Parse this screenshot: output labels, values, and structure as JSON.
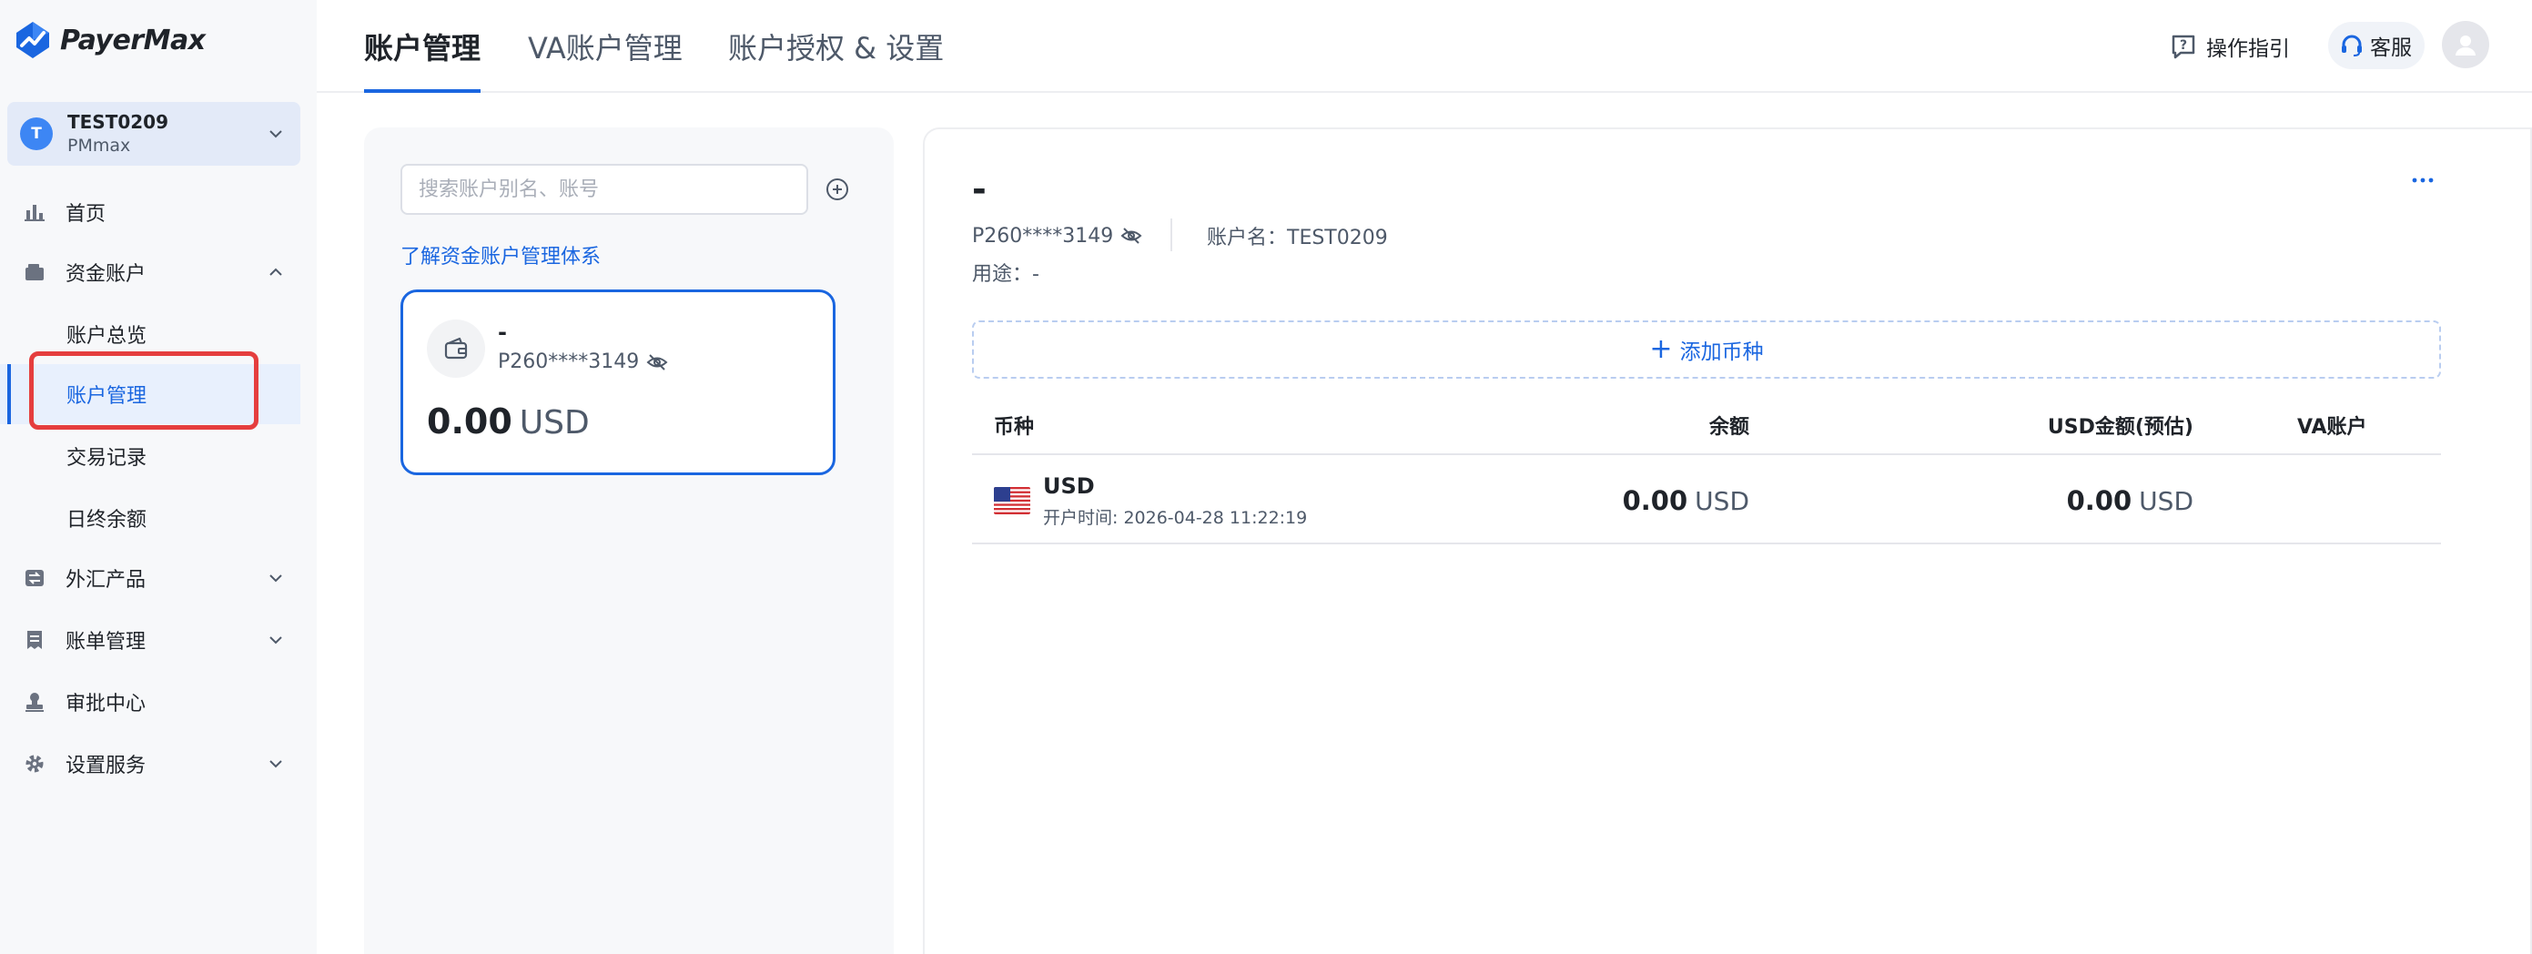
{
  "brand": {
    "name": "PayerMax"
  },
  "account_switch": {
    "avatar_letter": "T",
    "name": "TEST0209",
    "sub": "PMmax"
  },
  "nav": {
    "home": "首页",
    "funds": "资金账户",
    "funds_children": [
      "账户总览",
      "账户管理",
      "交易记录",
      "日终余额"
    ],
    "fx": "外汇产品",
    "bills": "账单管理",
    "approval": "审批中心",
    "settings": "设置服务"
  },
  "tabs": [
    "账户管理",
    "VA账户管理",
    "账户授权 & 设置"
  ],
  "header": {
    "guide": "操作指引",
    "service": "客服"
  },
  "left_panel": {
    "search_placeholder": "搜索账户别名、账号",
    "learn_link": "了解资金账户管理体系",
    "card": {
      "alias": "-",
      "number": "P260****3149",
      "amount": "0.00",
      "currency": "USD"
    }
  },
  "detail": {
    "title": "-",
    "number": "P260****3149",
    "account_name": "账户名：TEST0209",
    "usage": "用途：-",
    "add_currency": "添加币种",
    "columns": [
      "币种",
      "余额",
      "USD金额(预估)",
      "VA账户"
    ],
    "rows": [
      {
        "currency": "USD",
        "opened": "开户时间: 2026-04-28 11:22:19",
        "balance": "0.00",
        "balance_cur": "USD",
        "usd_amount": "0.00",
        "usd_cur": "USD",
        "va": ""
      }
    ]
  },
  "colors": {
    "accent": "#1a66e0",
    "highlight": "#e53e3e",
    "avatar": "#3d86f4"
  }
}
